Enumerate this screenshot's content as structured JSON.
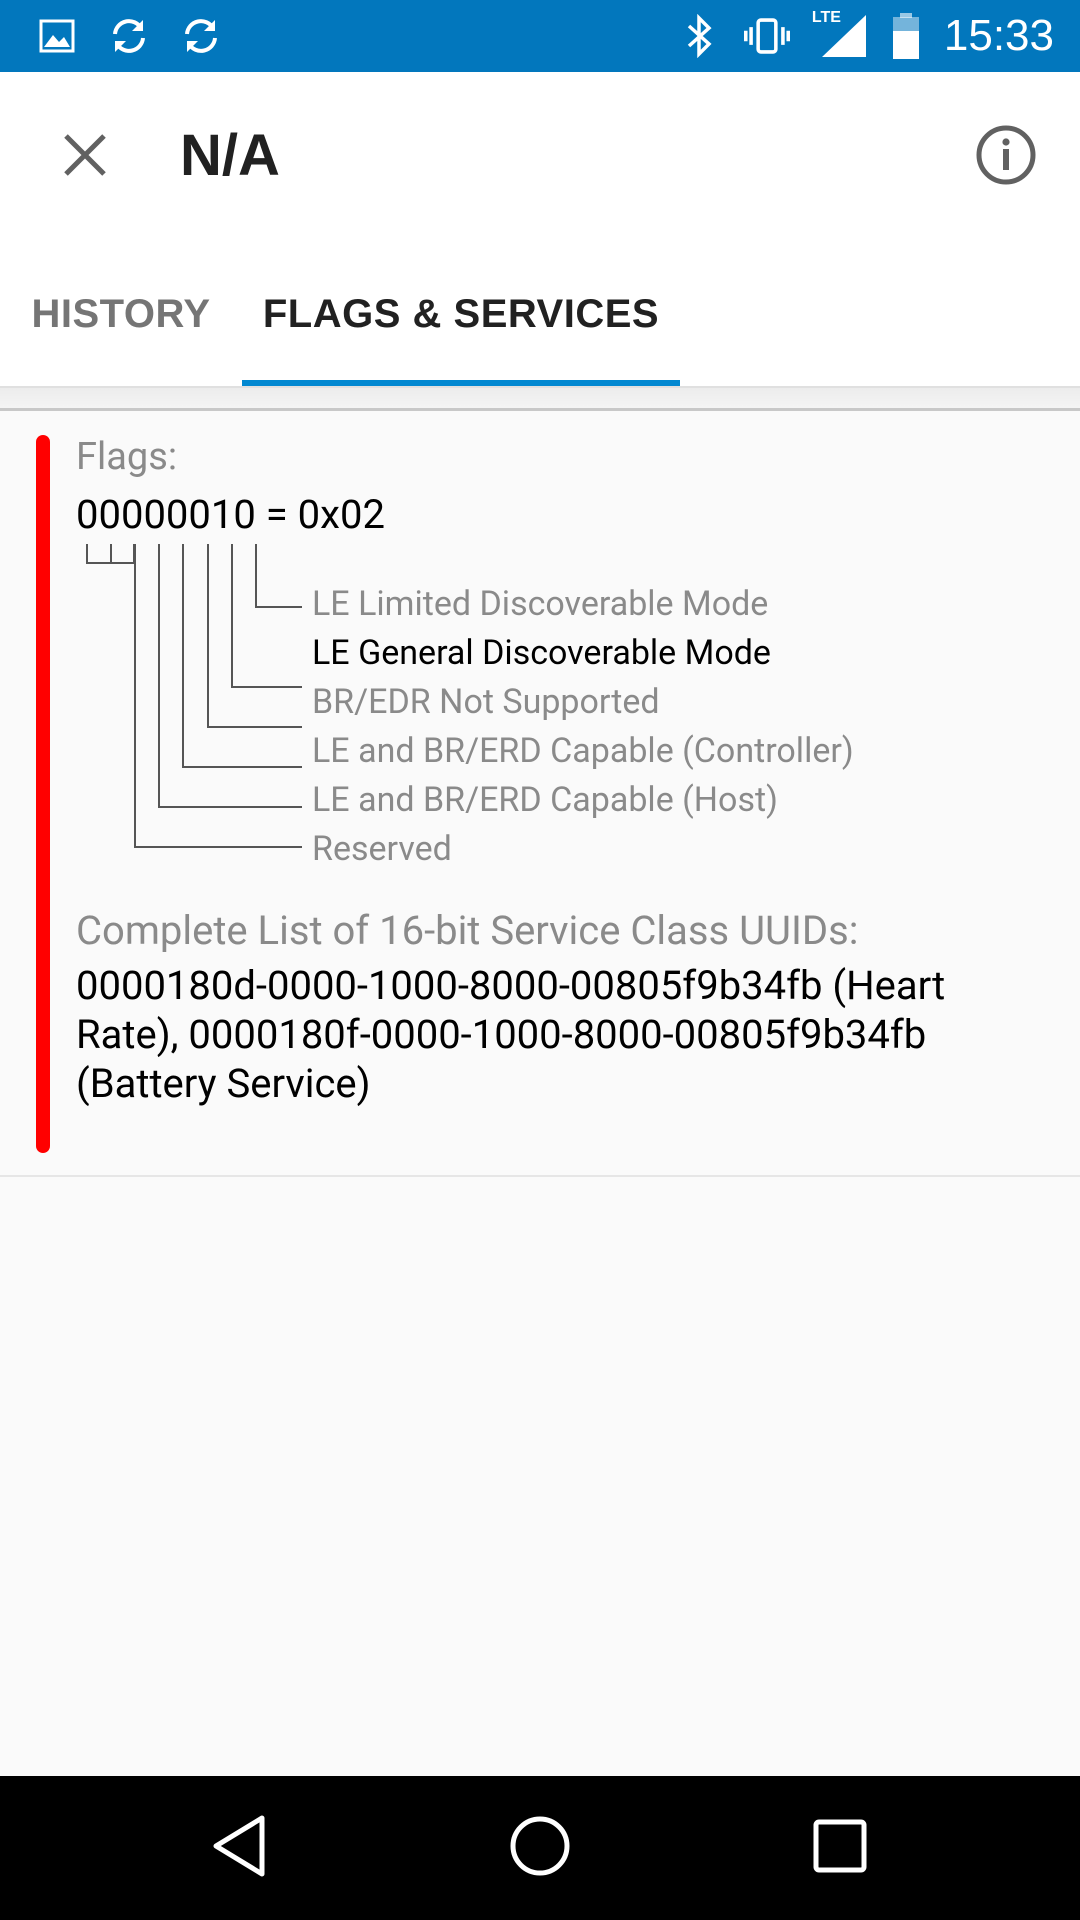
{
  "statusbar": {
    "time": "15:33",
    "left_icons": [
      "image-icon",
      "sync-icon",
      "sync-icon"
    ],
    "right_icons": [
      "bluetooth-icon",
      "vibrate-icon",
      "lte-signal-icon",
      "battery-icon"
    ],
    "network_label": "LTE"
  },
  "appbar": {
    "title": "N/A",
    "close_icon": "close-icon",
    "info_icon": "info-icon"
  },
  "tabs": [
    {
      "label": "HISTORY",
      "selected": false
    },
    {
      "label": "FLAGS & SERVICES",
      "selected": true
    }
  ],
  "flags": {
    "label": "Flags:",
    "value": "00000010 = 0x02",
    "items": [
      {
        "label": "LE Limited Discoverable Mode",
        "active": false
      },
      {
        "label": "LE General Discoverable Mode",
        "active": true
      },
      {
        "label": "BR/EDR Not Supported",
        "active": false
      },
      {
        "label": "LE and BR/ERD Capable (Controller)",
        "active": false
      },
      {
        "label": "LE and BR/ERD Capable (Host)",
        "active": false
      },
      {
        "label": "Reserved",
        "active": false
      }
    ]
  },
  "services": {
    "label": "Complete List of 16-bit Service Class UUIDs:",
    "value": "0000180d-0000-1000-8000-00805f9b34fb (Heart Rate), 0000180f-0000-1000-8000-00805f9b34fb (Battery Service)"
  },
  "colors": {
    "status_bar": "#0277bd",
    "accent": "#0288d1",
    "flag_indicator": "#ff0000"
  },
  "navbar": {
    "icons": [
      "back-icon",
      "home-icon",
      "recents-icon"
    ]
  }
}
